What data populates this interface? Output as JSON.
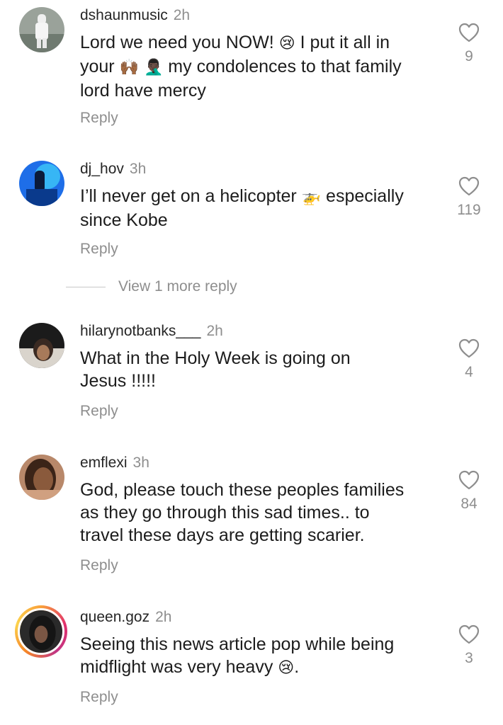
{
  "comments": [
    {
      "username": "dshaunmusic",
      "time": "2h",
      "lines": [
        [
          {
            "t": "Lord we need you NOW! "
          },
          {
            "e": "😢"
          },
          {
            "t": " I put it all in"
          }
        ],
        [
          {
            "t": "your "
          },
          {
            "e": "🙌🏾"
          },
          {
            "t": " "
          },
          {
            "e": "🤦🏿‍♂️"
          },
          {
            "t": " my condolences to that family"
          }
        ],
        [
          {
            "t": "lord have mercy"
          }
        ]
      ],
      "reply_label": "Reply",
      "likes": "9"
    },
    {
      "username": "dj_hov",
      "time": "3h",
      "lines": [
        [
          {
            "t": "I’ll never get on a helicopter "
          },
          {
            "e": "🚁"
          },
          {
            "t": " especially"
          }
        ],
        [
          {
            "t": "since Kobe"
          }
        ]
      ],
      "reply_label": "Reply",
      "likes": "119",
      "more_replies": "View 1 more reply"
    },
    {
      "username": "hilarynotbanks___",
      "time": "2h",
      "lines": [
        [
          {
            "t": "What in the Holy Week is going on"
          }
        ],
        [
          {
            "t": "Jesus !!!!!"
          }
        ]
      ],
      "reply_label": "Reply",
      "likes": "4"
    },
    {
      "username": "emflexi",
      "time": "3h",
      "lines": [
        [
          {
            "t": "God, please touch these peoples families"
          }
        ],
        [
          {
            "t": "as they go through this sad times.. to"
          }
        ],
        [
          {
            "t": "travel these days are getting scarier."
          }
        ]
      ],
      "reply_label": "Reply",
      "likes": "84"
    },
    {
      "username": "queen.goz",
      "time": "2h",
      "lines": [
        [
          {
            "t": "Seeing this news article pop while being"
          }
        ],
        [
          {
            "t": "midflight was very heavy "
          },
          {
            "e": "😢"
          },
          {
            "t": "."
          }
        ]
      ],
      "reply_label": "Reply",
      "likes": "3"
    }
  ],
  "icons": {
    "like": "heart-icon"
  },
  "colors": {
    "secondary_text": "#8e8e8e",
    "story_ring": "#e1306c"
  }
}
